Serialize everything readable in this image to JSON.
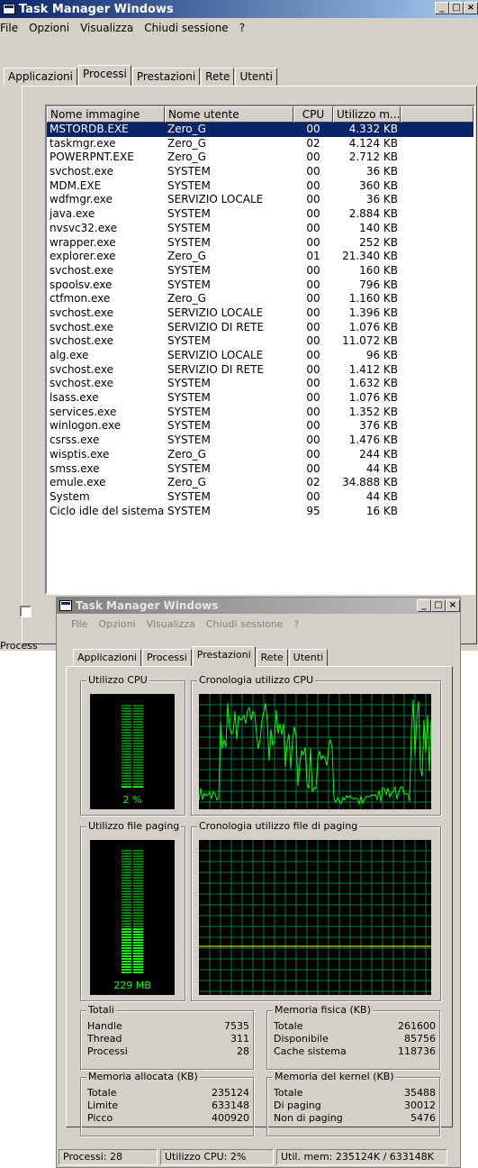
{
  "back": {
    "title": "Task Manager Windows",
    "menu": [
      "File",
      "Opzioni",
      "Visualizza",
      "Chiudi sessione",
      "?"
    ],
    "tabs": [
      "Applicazioni",
      "Processi",
      "Prestazioni",
      "Rete",
      "Utenti"
    ],
    "headers": [
      "Nome immagine",
      "Nome utente",
      "CPU",
      "Utilizzo m..."
    ],
    "rows": [
      [
        "MSTORDB.EXE",
        "Zero_G",
        "00",
        "4.332 KB"
      ],
      [
        "taskmgr.exe",
        "Zero_G",
        "02",
        "4.124 KB"
      ],
      [
        "POWERPNT.EXE",
        "Zero_G",
        "00",
        "2.712 KB"
      ],
      [
        "svchost.exe",
        "SYSTEM",
        "00",
        "36 KB"
      ],
      [
        "MDM.EXE",
        "SYSTEM",
        "00",
        "360 KB"
      ],
      [
        "wdfmgr.exe",
        "SERVIZIO LOCALE",
        "00",
        "36 KB"
      ],
      [
        "java.exe",
        "SYSTEM",
        "00",
        "2.884 KB"
      ],
      [
        "nvsvc32.exe",
        "SYSTEM",
        "00",
        "140 KB"
      ],
      [
        "wrapper.exe",
        "SYSTEM",
        "00",
        "252 KB"
      ],
      [
        "explorer.exe",
        "Zero_G",
        "01",
        "21.340 KB"
      ],
      [
        "svchost.exe",
        "SYSTEM",
        "00",
        "160 KB"
      ],
      [
        "spoolsv.exe",
        "SYSTEM",
        "00",
        "796 KB"
      ],
      [
        "ctfmon.exe",
        "Zero_G",
        "00",
        "1.160 KB"
      ],
      [
        "svchost.exe",
        "SERVIZIO LOCALE",
        "00",
        "1.396 KB"
      ],
      [
        "svchost.exe",
        "SERVIZIO DI RETE",
        "00",
        "1.076 KB"
      ],
      [
        "svchost.exe",
        "SYSTEM",
        "00",
        "11.072 KB"
      ],
      [
        "alg.exe",
        "SERVIZIO LOCALE",
        "00",
        "96 KB"
      ],
      [
        "svchost.exe",
        "SERVIZIO DI RETE",
        "00",
        "1.412 KB"
      ],
      [
        "svchost.exe",
        "SYSTEM",
        "00",
        "1.632 KB"
      ],
      [
        "lsass.exe",
        "SYSTEM",
        "00",
        "1.076 KB"
      ],
      [
        "services.exe",
        "SYSTEM",
        "00",
        "1.352 KB"
      ],
      [
        "winlogon.exe",
        "SYSTEM",
        "00",
        "376 KB"
      ],
      [
        "csrss.exe",
        "SYSTEM",
        "00",
        "1.476 KB"
      ],
      [
        "wisptis.exe",
        "Zero_G",
        "00",
        "244 KB"
      ],
      [
        "smss.exe",
        "SYSTEM",
        "00",
        "44 KB"
      ],
      [
        "emule.exe",
        "Zero_G",
        "02",
        "34.888 KB"
      ],
      [
        "System",
        "SYSTEM",
        "00",
        "44 KB"
      ],
      [
        "Ciclo idle del sistema",
        "SYSTEM",
        "95",
        "16 KB"
      ]
    ],
    "status_left": "Process"
  },
  "front": {
    "title": "Task Manager Windows",
    "menu": [
      "File",
      "Opzioni",
      "Visualizza",
      "Chiudi sessione",
      "?"
    ],
    "tabs": [
      "Applicazioni",
      "Processi",
      "Prestazioni",
      "Rete",
      "Utenti"
    ],
    "cpu_label": "Utilizzo CPU",
    "cpu_value": "2 %",
    "cpu_level": 0.02,
    "cpu_hist_label": "Cronologia utilizzo CPU",
    "page_label": "Utilizzo file paging",
    "page_value": "229 MB",
    "page_level": 0.36,
    "page_hist_label": "Cronologia utilizzo file di paging",
    "totali": {
      "label": "Totali",
      "rows": [
        [
          "Handle",
          "7535"
        ],
        [
          "Thread",
          "311"
        ],
        [
          "Processi",
          "28"
        ]
      ]
    },
    "fisica": {
      "label": "Memoria fisica (KB)",
      "rows": [
        [
          "Totale",
          "261600"
        ],
        [
          "Disponibile",
          "85756"
        ],
        [
          "Cache sistema",
          "118736"
        ]
      ]
    },
    "allocata": {
      "label": "Memoria allocata (KB)",
      "rows": [
        [
          "Totale",
          "235124"
        ],
        [
          "Limite",
          "633148"
        ],
        [
          "Picco",
          "400920"
        ]
      ]
    },
    "kernel": {
      "label": "Memoria del kernel (KB)",
      "rows": [
        [
          "Totale",
          "35488"
        ],
        [
          "Di paging",
          "30012"
        ],
        [
          "Non di paging",
          "5476"
        ]
      ]
    },
    "status": [
      "Processi: 28",
      "Utilizzo CPU: 2%",
      "Util. mem: 235124K / 633148K"
    ],
    "colors": {
      "graph_line": "#00ff00",
      "grid": "#008040",
      "page_line": "#ffff00"
    }
  }
}
